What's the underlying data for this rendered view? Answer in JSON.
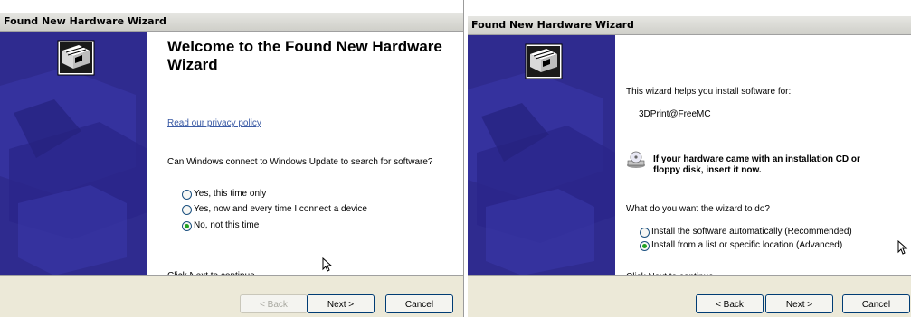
{
  "left_window": {
    "title": "Found New Hardware Wizard",
    "heading_line1": "Welcome to the Found New Hardware",
    "heading_line2": "Wizard",
    "privacy_link": "Read our privacy policy",
    "question": "Can Windows connect to Windows Update to search for software?",
    "options": [
      {
        "label": "Yes, this time only",
        "selected": false
      },
      {
        "label": "Yes, now and every time I connect a device",
        "selected": false
      },
      {
        "label": "No, not this time",
        "selected": true
      }
    ],
    "footer": "Click Next to continue.",
    "buttons": {
      "back": "< Back",
      "next": "Next >",
      "cancel": "Cancel"
    }
  },
  "right_window": {
    "title": "Found New Hardware Wizard",
    "intro": "This wizard helps you install software for:",
    "device_name": "3DPrint@FreeMC",
    "cd_notice_line1": "If your hardware came with an installation CD or",
    "cd_notice_line2": "floppy disk, insert it now.",
    "question": "What do you want the wizard to do?",
    "options": [
      {
        "label": "Install the software automatically (Recommended)",
        "selected": false
      },
      {
        "label": "Install from a list or specific location (Advanced)",
        "selected": true
      }
    ],
    "footer": "Click Next to continue.",
    "buttons": {
      "back": "< Back",
      "next": "Next >",
      "cancel": "Cancel"
    }
  },
  "icons": {
    "hardware": "hardware-wizard-icon",
    "cd": "cd-drive-icon",
    "cursor": "mouse-pointer-icon"
  },
  "colors": {
    "side_panel": "#2f2b8f",
    "button_bar": "#ece9d8",
    "link": "#3b5ba5",
    "radio_selected": "#21a121"
  }
}
